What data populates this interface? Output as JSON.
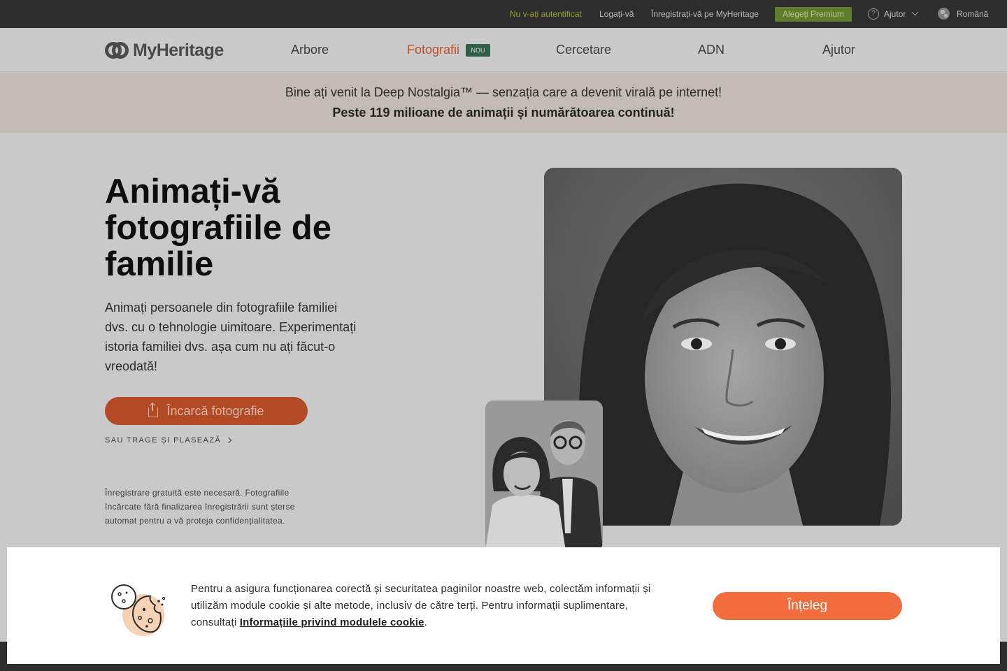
{
  "topbar": {
    "not_authenticated": "Nu v-ați autentificat",
    "login": "Logați-vă",
    "register": "Înregistrați-vă pe MyHeritage",
    "premium": "Alegeți Premium",
    "help": "Ajutor",
    "language": "Română"
  },
  "nav": {
    "brand": "MyHeritage",
    "items": [
      "Arbore",
      "Fotografii",
      "Cercetare",
      "ADN",
      "Ajutor"
    ],
    "active": "Fotografii",
    "badge": "NOU"
  },
  "announcement": {
    "line1": "Bine ați venit la Deep Nostalgia™ — senzația care a devenit virală pe internet!",
    "line2": "Peste 119 milioane de animații și numărătoarea continuă!"
  },
  "hero": {
    "title": "Animați-vă fotografiile de familie",
    "description": "Animați persoanele din fotografiile familiei dvs. cu o tehnologie uimitoare. Experimentați istoria familiei dvs. așa cum nu ați făcut-o vreodată!",
    "upload_button": "Încarcă fotografie",
    "drag_drop": "SAU TRAGE ȘI PLASEAZĂ",
    "legal": "Înregistrare gratuită este necesară. Fotografiile încărcate fără finalizarea înregistrării sunt șterse automat pentru a vă proteja confidențialitatea."
  },
  "cookie_banner": {
    "text_before": "Pentru a asigura funcționarea corectă și securitatea paginilor noastre web, colectăm informații și utilizăm module cookie și alte metode, inclusiv de către terți. Pentru informații suplimentare, consultați ",
    "link": "Informațiile privind modulele cookie",
    "text_after": ".",
    "accept": "Înțeleg"
  },
  "colors": {
    "accent": "#f26d3d",
    "active_nav": "#c0502b",
    "badge": "#2f5e49",
    "premium": "#5f7d2c"
  }
}
